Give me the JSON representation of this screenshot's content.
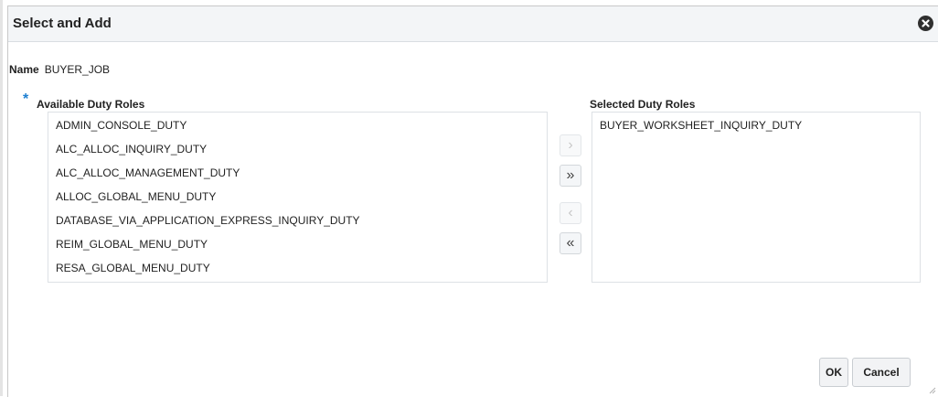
{
  "dialog": {
    "title": "Select and Add",
    "close_icon": "close-circle-icon"
  },
  "name_field": {
    "label": "Name",
    "value": "BUYER_JOB"
  },
  "available": {
    "required_marker": "*",
    "label": "Available Duty Roles",
    "items": [
      "ADMIN_CONSOLE_DUTY",
      "ALC_ALLOC_INQUIRY_DUTY",
      "ALC_ALLOC_MANAGEMENT_DUTY",
      "ALLOC_GLOBAL_MENU_DUTY",
      "DATABASE_VIA_APPLICATION_EXPRESS_INQUIRY_DUTY",
      "REIM_GLOBAL_MENU_DUTY",
      "RESA_GLOBAL_MENU_DUTY"
    ]
  },
  "selected": {
    "label": "Selected Duty Roles",
    "items": [
      "BUYER_WORKSHEET_INQUIRY_DUTY"
    ]
  },
  "shuttle": {
    "move": "›",
    "move_all": "»",
    "remove": "‹",
    "remove_all": "«"
  },
  "footer": {
    "ok_label": "OK",
    "cancel_label": "Cancel"
  },
  "colors": {
    "required_marker": "#1d7fd1",
    "title_bar": "#f3f5f7"
  }
}
